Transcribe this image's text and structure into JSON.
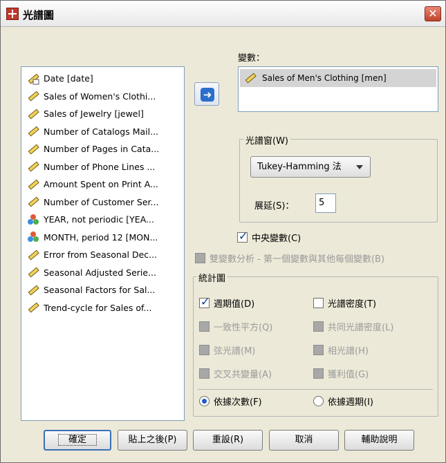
{
  "window": {
    "title": "光譜圖",
    "close_label": "✕"
  },
  "source_list": {
    "items": [
      {
        "label": "Date [date]",
        "icon": "date-ruler-icon"
      },
      {
        "label": "Sales of Women's Clothi...",
        "icon": "scale-ruler-icon"
      },
      {
        "label": "Sales of Jewelry [jewel]",
        "icon": "scale-ruler-icon"
      },
      {
        "label": "Number of Catalogs Mail...",
        "icon": "scale-ruler-icon"
      },
      {
        "label": "Number of Pages in Cata...",
        "icon": "scale-ruler-icon"
      },
      {
        "label": "Number of Phone Lines ...",
        "icon": "scale-ruler-icon"
      },
      {
        "label": "Amount Spent on Print A...",
        "icon": "scale-ruler-icon"
      },
      {
        "label": "Number of Customer Ser...",
        "icon": "scale-ruler-icon"
      },
      {
        "label": "YEAR, not periodic [YEA...",
        "icon": "nominal-circles-icon"
      },
      {
        "label": "MONTH, period 12 [MON...",
        "icon": "nominal-circles-icon"
      },
      {
        "label": "Error from Seasonal Dec...",
        "icon": "scale-ruler-icon"
      },
      {
        "label": "Seasonal Adjusted Serie...",
        "icon": "scale-ruler-icon"
      },
      {
        "label": "Seasonal Factors for Sal...",
        "icon": "scale-ruler-icon"
      },
      {
        "label": "Trend-cycle for Sales of...",
        "icon": "scale-ruler-icon"
      }
    ]
  },
  "move_button": {
    "icon": "arrow-right-icon",
    "glyph": "➜"
  },
  "variables": {
    "label": "變數：",
    "items": [
      {
        "label": "Sales of Men's Clothing [men]",
        "icon": "scale-ruler-icon"
      }
    ]
  },
  "spectral_window": {
    "title": "光譜窗(W)",
    "selected": "Tukey-Hamming 法",
    "span_label": "展延(S)：",
    "span_value": "5"
  },
  "center_variables": {
    "label": "中央變數(C)",
    "checked": true
  },
  "bivariate": {
    "label": "雙變數分析 - 第一個變數與其他每個變數(B)",
    "checked": false,
    "enabled": false
  },
  "plots": {
    "title": "統計圖",
    "left": [
      {
        "label": "週期值(D)",
        "checked": true,
        "enabled": true
      },
      {
        "label": "一致性平方(Q)",
        "checked": false,
        "enabled": false
      },
      {
        "label": "弦光譜(M)",
        "checked": false,
        "enabled": false
      },
      {
        "label": "交叉共變量(A)",
        "checked": false,
        "enabled": false
      }
    ],
    "right": [
      {
        "label": "光譜密度(T)",
        "checked": false,
        "enabled": true
      },
      {
        "label": "共同光譜密度(L)",
        "checked": false,
        "enabled": false
      },
      {
        "label": "相光譜(H)",
        "checked": false,
        "enabled": false
      },
      {
        "label": "獲利值(G)",
        "checked": false,
        "enabled": false
      }
    ],
    "radio_frequency": {
      "label": "依據次數(F)",
      "selected": true
    },
    "radio_period": {
      "label": "依據週期(I)",
      "selected": false
    }
  },
  "buttons": {
    "ok": "確定",
    "paste": "貼上之後(P)",
    "reset": "重設(R)",
    "cancel": "取消",
    "help": "輔助說明"
  },
  "colors": {
    "dialog_bg": "#ece9d8",
    "accent": "#2a6fcb",
    "close": "#c0432a"
  }
}
